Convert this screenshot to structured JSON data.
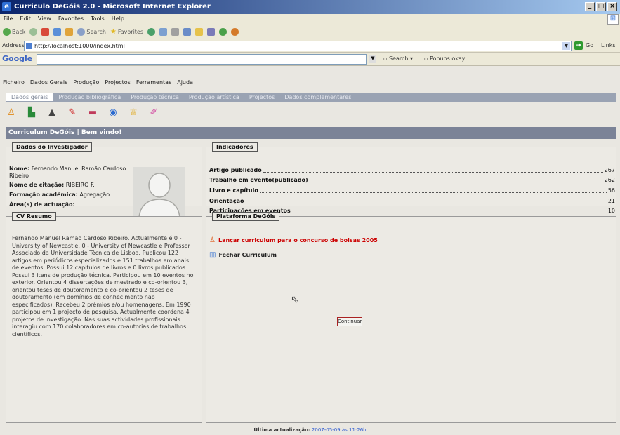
{
  "window": {
    "title": "Curriculo DeGóis 2.0 - Microsoft Internet Explorer"
  },
  "browser_menu": [
    "File",
    "Edit",
    "View",
    "Favorites",
    "Tools",
    "Help"
  ],
  "toolbar": {
    "back": "Back",
    "search": "Search",
    "favorites": "Favorites"
  },
  "address": {
    "label": "Address",
    "url": "http://localhost:1000/index.html",
    "go_label": "Go",
    "links_label": "Links"
  },
  "google": {
    "logo": "Google",
    "search_label": "Search",
    "popups_label": "Popups okay"
  },
  "app_menu": [
    "Ficheiro",
    "Dados Gerais",
    "Produção",
    "Projectos",
    "Ferramentas",
    "Ajuda"
  ],
  "tabs": [
    "Dados gerais",
    "Produção bibliográfica",
    "Produção técnica",
    "Produção artística",
    "Projectos",
    "Dados complementares"
  ],
  "welcome": "Curriculum DeGóis | Bem vindo!",
  "investigador": {
    "legend": "Dados do Investigador",
    "name_label": "Nome:",
    "name_value": "Fernando Manuel Ramão Cardoso Ribeiro",
    "citation_label": "Nome de citação:",
    "citation_value": "RIBEIRO F.",
    "formation_label": "Formação académica:",
    "formation_value": "Agregação",
    "area_label": "Área(s) de actuação:",
    "area_value": ""
  },
  "indicadores": {
    "legend": "Indicadores",
    "items": [
      {
        "name": "Artigo publicado",
        "value": "267"
      },
      {
        "name": "Trabalho em evento(publicado)",
        "value": "262"
      },
      {
        "name": "Livro e capítulo",
        "value": "56"
      },
      {
        "name": "Orientação",
        "value": "21"
      },
      {
        "name": "Participações em eventos",
        "value": "10"
      }
    ]
  },
  "cv": {
    "legend": "CV Resumo",
    "text": "Fernando Manuel Ramão Cardoso Ribeiro. Actualmente é 0 - University of Newcastle, 0 - University of Newcastle e Professor Associado da Universidade Técnica de Lisboa. Publicou 122 artigos em periódicos especializados e 151 trabalhos em anais de eventos. Possui 12 capítulos de livros e 0 livros publicados. Possui 3 itens de produção técnica. Participou em 10 eventos no exterior. Orientou 4 dissertações de mestrado e co-orientou 3, orientou teses de doutoramento e co-orientou 2 teses de doutoramento (em domínios de conhecimento não especificados). Recebeu 2 prémios e/ou homenagens. Em 1990 participou em 1 projecto de pesquisa. Actualmente coordena 4 projetos de investigação. Nas suas actividades profissionais interagiu com 170 colaboradores em co-autorias de trabalhos científicos."
  },
  "plataforma": {
    "legend": "Plataforma DeGóis",
    "link_launch": "Lançar curriculum para o concurso de bolsas 2005",
    "link_close": "Fechar Curriculum",
    "continue_button": "Continuar"
  },
  "footer": {
    "label": "Última actualização:",
    "date": "2007-05-09 às 11:26h"
  }
}
